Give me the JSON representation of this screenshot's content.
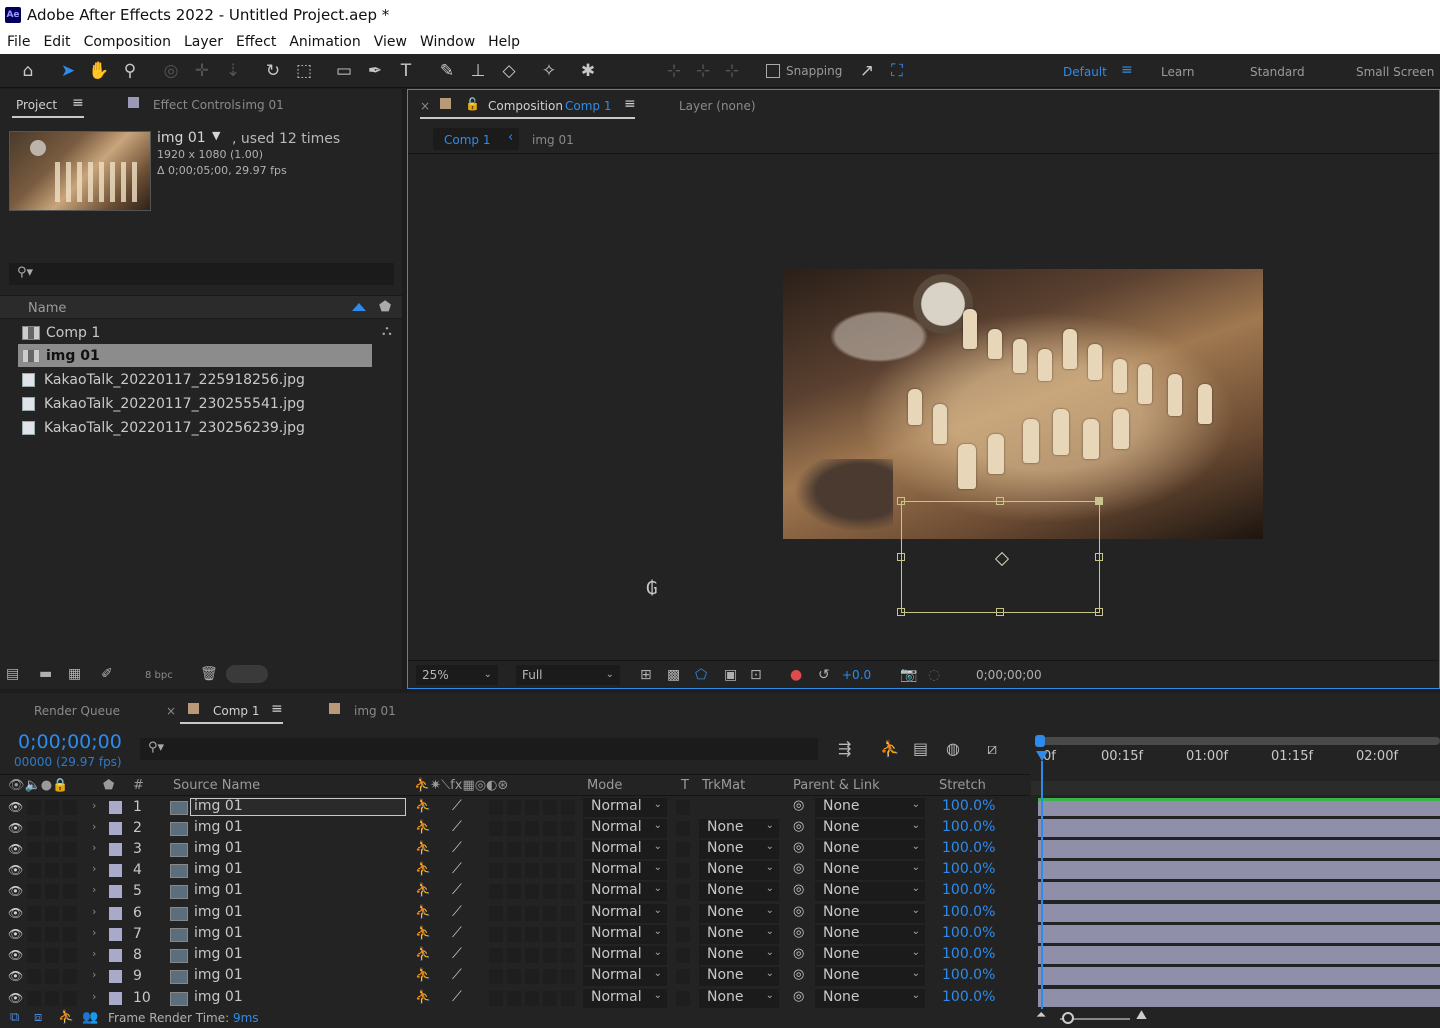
{
  "window": {
    "title": "Adobe After Effects 2022 - Untitled Project.aep *",
    "logo_text": "Ae"
  },
  "menu": [
    "File",
    "Edit",
    "Composition",
    "Layer",
    "Effect",
    "Animation",
    "View",
    "Window",
    "Help"
  ],
  "toolbar": {
    "snapping_label": "Snapping",
    "workspaces": [
      "Default",
      "Learn",
      "Standard",
      "Small Screen"
    ],
    "active_workspace": "Default"
  },
  "project_panel": {
    "tab_project": "Project",
    "tab_effect_controls": "Effect Controls",
    "effect_controls_target": "img 01",
    "selected": {
      "name": "img 01",
      "usage": ", used 12 times",
      "dimensions": "1920 x 1080 (1.00)",
      "duration": "Δ 0;00;05;00, 29.97 fps"
    },
    "search_placeholder": "",
    "column_name": "Name",
    "items": [
      {
        "name": "Comp 1",
        "type": "comp"
      },
      {
        "name": "img 01",
        "type": "comp",
        "selected": true
      },
      {
        "name": "KakaoTalk_20220117_225918256.jpg",
        "type": "image"
      },
      {
        "name": "KakaoTalk_20220117_230255541.jpg",
        "type": "image"
      },
      {
        "name": "KakaoTalk_20220117_230256239.jpg",
        "type": "image"
      }
    ],
    "bit_depth": "8 bpc"
  },
  "composition_panel": {
    "tab_label": "Composition",
    "comp_name": "Comp 1",
    "layer_tab": "Layer (none)",
    "breadcrumb": [
      "Comp 1",
      "img 01"
    ],
    "zoom": "25%",
    "resolution": "Full",
    "exposure": "+0.0",
    "timecode": "0;00;00;00"
  },
  "timeline_panel": {
    "tab_render_queue": "Render Queue",
    "tab_comp1": "Comp 1",
    "tab_img01": "img 01",
    "timecode": "0;00;00;00",
    "timecode_sub": "00000 (29.97 fps)",
    "columns": {
      "number": "#",
      "source_name": "Source Name",
      "mode": "Mode",
      "t": "T",
      "trkmat": "TrkMat",
      "parent": "Parent & Link",
      "stretch": "Stretch"
    },
    "ticks": [
      "0f",
      "00:15f",
      "01:00f",
      "01:15f",
      "02:00f"
    ],
    "layers": [
      {
        "num": "1",
        "name": "img 01",
        "mode": "Normal",
        "trkmat": "",
        "parent": "None",
        "stretch": "100.0%"
      },
      {
        "num": "2",
        "name": "img 01",
        "mode": "Normal",
        "trkmat": "None",
        "parent": "None",
        "stretch": "100.0%"
      },
      {
        "num": "3",
        "name": "img 01",
        "mode": "Normal",
        "trkmat": "None",
        "parent": "None",
        "stretch": "100.0%"
      },
      {
        "num": "4",
        "name": "img 01",
        "mode": "Normal",
        "trkmat": "None",
        "parent": "None",
        "stretch": "100.0%"
      },
      {
        "num": "5",
        "name": "img 01",
        "mode": "Normal",
        "trkmat": "None",
        "parent": "None",
        "stretch": "100.0%"
      },
      {
        "num": "6",
        "name": "img 01",
        "mode": "Normal",
        "trkmat": "None",
        "parent": "None",
        "stretch": "100.0%"
      },
      {
        "num": "7",
        "name": "img 01",
        "mode": "Normal",
        "trkmat": "None",
        "parent": "None",
        "stretch": "100.0%"
      },
      {
        "num": "8",
        "name": "img 01",
        "mode": "Normal",
        "trkmat": "None",
        "parent": "None",
        "stretch": "100.0%"
      },
      {
        "num": "9",
        "name": "img 01",
        "mode": "Normal",
        "trkmat": "None",
        "parent": "None",
        "stretch": "100.0%"
      },
      {
        "num": "10",
        "name": "img 01",
        "mode": "Normal",
        "trkmat": "None",
        "parent": "None",
        "stretch": "100.0%"
      }
    ],
    "frame_render_label": "Frame Render Time:",
    "frame_render_value": "9ms"
  },
  "colors": {
    "accent": "#2d8ceb",
    "label": "#a9a9c9",
    "layer_bar": "#8f8fa9",
    "handle": "#c9c58a"
  }
}
